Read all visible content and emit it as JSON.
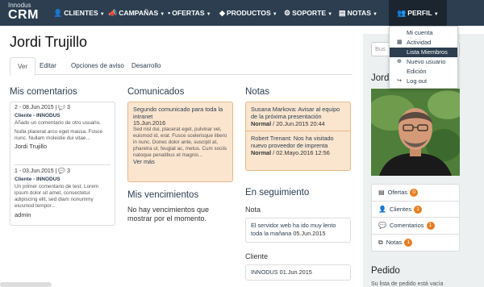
{
  "brand": {
    "small": "Innodus",
    "large": "CRM"
  },
  "nav": [
    {
      "icon": "user-icon",
      "glyph": "👤",
      "label": "CLIENTES"
    },
    {
      "icon": "megaphone-icon",
      "glyph": "📣",
      "label": "CAMPAÑAS"
    },
    {
      "icon": "briefcase-icon",
      "glyph": "▪",
      "label": "OFERTAS"
    },
    {
      "icon": "box-icon",
      "glyph": "◆",
      "label": "PRODUCTOS"
    },
    {
      "icon": "support-icon",
      "glyph": "⚙",
      "label": "SOPORTE"
    },
    {
      "icon": "notes-icon",
      "glyph": "▤",
      "label": "NOTAS"
    }
  ],
  "perfil": {
    "label": "PERFIL",
    "menu": [
      {
        "label": "Mi cuenta",
        "glyph": ""
      },
      {
        "label": "Actividad",
        "glyph": "▦"
      },
      {
        "label": "Lista Miembros",
        "glyph": "",
        "active": true
      },
      {
        "label": "Nuevo usuario",
        "glyph": "⊕"
      },
      {
        "label": "Edición",
        "glyph": ""
      },
      {
        "label": "Log out",
        "glyph": "↪"
      }
    ]
  },
  "page_title": "Jordi Trujillo",
  "tabs": [
    "Ver",
    "Editar",
    "Opciones de aviso",
    "Desarrollo"
  ],
  "mis_comentarios": {
    "heading": "Mis comentarios",
    "items": [
      {
        "head": "2 - 08.Jun.2015 |",
        "count": "3",
        "client": "Cliente - INNODUS",
        "text1": "Añado un comentario de otro usuario.",
        "text2": "Nulla placerat arcu eget massa. Fusce nunc. Nullam molestie dui vitae...",
        "author": "Jordi Trujillo"
      },
      {
        "head": "1 - 03.Jun.2015 |",
        "count": "3",
        "client": "Cliente - INNODUS",
        "text1": "Un primer comentario de test. Lorem ipsum dolor sit amet, consectetur adipiscing elit, sed diam nonummy eiusmod tempor...",
        "text2": "",
        "author": "admin"
      }
    ]
  },
  "comunicados": {
    "heading": "Comunicados",
    "title": "Segundo comunicado para toda la intranet",
    "date": "15.Jun.2016",
    "body": "Sed nisl dui, placerat eget, pulvinar vel, euismod id, erat. Fusce scelerisque libero in nunc. Donec dolor ante, suscipit at, pharetra ut, feugiat ac, metus. Cum sociis natoque penatibus et magnis...",
    "more": "Ver más"
  },
  "mis_vencimientos": {
    "heading": "Mis vencimientos",
    "text": "No hay vencimientos que mostrar por el momento."
  },
  "notas": {
    "heading": "Notas",
    "items": [
      {
        "title": "Susana Markova: Avisar al equipo de la próxima presentación",
        "priority": "Normal",
        "date": " / 20.Jun.2015 20:44"
      },
      {
        "title": "Robert Trenant: Nos ha visitado nuevo proveedor de imprenta",
        "priority": "Normal",
        "date": " / 02.Mayo.2016 12:56"
      }
    ]
  },
  "en_seguimiento": {
    "heading": "En seguimiento",
    "nota_label": "Nota",
    "nota_text": "El servidor web ha ido muy lento toda la mañana",
    "nota_date": " 05.Jun.2015",
    "cliente_label": "Cliente",
    "cliente_text": "INNODUS",
    "cliente_date": " 01.Jun.2015"
  },
  "sidebar": {
    "search_placeholder": "Bus",
    "name": "Jord",
    "links": [
      {
        "label": "Ofertas",
        "count": "0",
        "glyph": "▤"
      },
      {
        "label": "Clientes",
        "count": "1",
        "glyph": "👤"
      },
      {
        "label": "Comentarios",
        "count": "1",
        "glyph": "💬"
      },
      {
        "label": "Notas",
        "count": "1",
        "glyph": "⧉"
      }
    ],
    "pedido_heading": "Pedido",
    "pedido_text": "Su lista de pedido está vacía"
  },
  "colors": {
    "navbar": "#2c3e50",
    "badge": "#e67e22",
    "notice_bg": "#fbe5cf"
  }
}
